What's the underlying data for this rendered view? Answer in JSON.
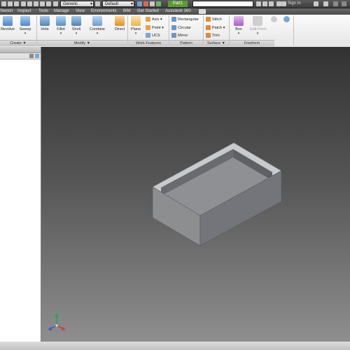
{
  "quick_access": {
    "material_combo": "Generic",
    "appearance_combo": "Default",
    "document_tab": "Part1",
    "search_placeholder": "",
    "sign_in": "Sign In"
  },
  "menubar": {
    "items": [
      "Sketch",
      "Inspect",
      "Tools",
      "Manage",
      "View",
      "Environments",
      "BIM",
      "Get Started",
      "Autodesk 360"
    ]
  },
  "ribbon": {
    "create": {
      "revolve": "Revolve",
      "sweep": "Sweep",
      "panel": "Create"
    },
    "modify": {
      "hole": "Hole",
      "fillet": "Fillet",
      "shell": "Shell",
      "combine": "Combine",
      "direct": "Direct",
      "panel": "Modify"
    },
    "work_features": {
      "plane": "Plane",
      "axis": "Axis",
      "point": "Point",
      "ucs": "UCS",
      "panel": "Work Features"
    },
    "pattern": {
      "rectangular": "Rectangular",
      "circular": "Circular",
      "mirror": "Mirror",
      "panel": "Pattern"
    },
    "surface": {
      "stitch": "Stitch",
      "patch": "Patch",
      "trim": "Trim",
      "panel": "Surface"
    },
    "freeform": {
      "box": "Box",
      "edit_form": "Edit Form",
      "panel": "Freeform"
    },
    "panel_arrow": "▼"
  },
  "colors": {
    "accent_green": "#5d9a3a",
    "model_top": "#c9cacb",
    "model_left": "#8d8e90",
    "model_right": "#74757a",
    "viewport_top": "#323232",
    "viewport_bottom": "#8e8e8e"
  }
}
